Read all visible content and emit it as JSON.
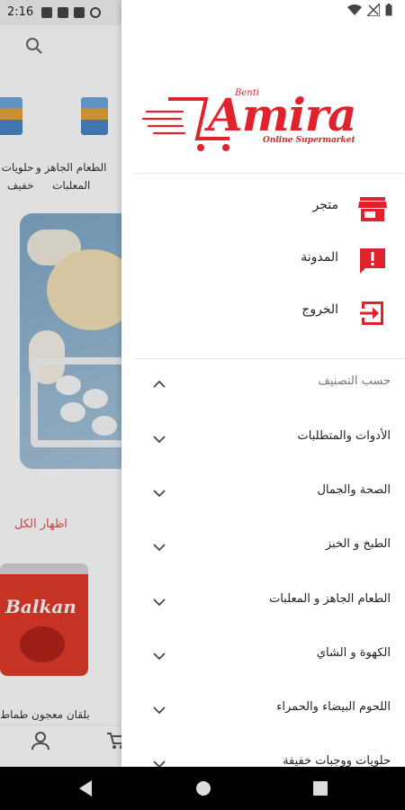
{
  "status_bar": {
    "time": "2:16"
  },
  "background": {
    "categories": [
      {
        "label_line1": "حلويات و",
        "label_line2": "خفيف"
      },
      {
        "label_line1": "الطعام الجاهز و",
        "label_line2": "المعلبات"
      }
    ],
    "show_all": "اظهار الكل",
    "product": {
      "brand": "Balkan",
      "name": "بلقان معجون طماط"
    }
  },
  "drawer": {
    "logo": {
      "benti": "Benti",
      "word": "Amira",
      "tagline": "Online Supermarket"
    },
    "menu": [
      {
        "label": "متجر",
        "icon": "store-icon"
      },
      {
        "label": "المدونة",
        "icon": "feedback-icon"
      },
      {
        "label": "الخروج",
        "icon": "logout-icon"
      }
    ],
    "categories_header": "حسب التصنيف",
    "categories": [
      "الأدوات والمتطلبات",
      "الصحة والجمال",
      "الطبخ و الخبز",
      "الطعام الجاهز و المعلبات",
      "الكهوة و الشاي",
      "اللحوم البيضاء والحمراء",
      "حلويات ووجبات خفيفة"
    ]
  },
  "colors": {
    "accent": "#e0222d",
    "text": "#222222",
    "muted": "#777777"
  }
}
